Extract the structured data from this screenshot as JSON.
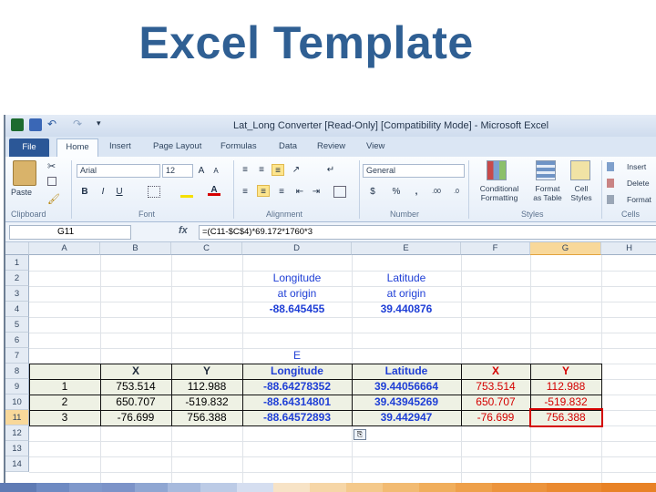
{
  "slide": {
    "title": "Excel Template"
  },
  "window": {
    "title": "Lat_Long Converter [Read-Only] [Compatibility Mode] - Microsoft Excel"
  },
  "tabs": [
    "File",
    "Home",
    "Insert",
    "Page Layout",
    "Formulas",
    "Data",
    "Review",
    "View"
  ],
  "ribbon": {
    "clipboard": {
      "paste": "Paste",
      "label": "Clipboard"
    },
    "font": {
      "name": "Arial",
      "size": "12",
      "label": "Font",
      "bold": "B",
      "italic": "I",
      "underline": "U"
    },
    "alignment": {
      "label": "Alignment"
    },
    "number": {
      "format": "General",
      "label": "Number",
      "currency": "$",
      "percent": "%",
      "comma": ","
    },
    "styles": {
      "conditional": "Conditional Formatting",
      "table": "Format as Table",
      "cell": "Cell Styles",
      "label": "Styles"
    },
    "cells": {
      "insert": "Insert",
      "delete": "Delete",
      "format": "Format",
      "label": "Cells"
    }
  },
  "formula_bar": {
    "name_box": "G11",
    "fx": "fx",
    "formula": "=(C11-$C$4)*69.172*1760*3"
  },
  "columns": [
    "A",
    "B",
    "C",
    "D",
    "E",
    "F",
    "G",
    "H"
  ],
  "rows": [
    "1",
    "2",
    "3",
    "4",
    "5",
    "6",
    "7",
    "8",
    "9",
    "10",
    "11",
    "12",
    "13",
    "14"
  ],
  "sheet": {
    "origin_long_label1": "Longitude",
    "origin_long_label2": "at origin",
    "origin_long_value": "-88.645455",
    "origin_lat_label1": "Latitude",
    "origin_lat_label2": "at origin",
    "origin_lat_value": "39.440876",
    "e_label": "E",
    "headers": [
      "X",
      "Y",
      "Longitude",
      "Latitude",
      "X",
      "Y"
    ],
    "data": [
      {
        "a": "1",
        "b": "753.514",
        "c": "112.988",
        "d": "-88.64278352",
        "e": "39.44056664",
        "f": "753.514",
        "g": "112.988"
      },
      {
        "a": "2",
        "b": "650.707",
        "c": "-519.832",
        "d": "-88.64314801",
        "e": "39.43945269",
        "f": "650.707",
        "g": "-519.832"
      },
      {
        "a": "3",
        "b": "-76.699",
        "c": "756.388",
        "d": "-88.64572893",
        "e": "39.442947",
        "f": "-76.699",
        "g": "756.388"
      }
    ]
  },
  "colors": {
    "title": "#2f5f93",
    "blue": "#1f3fd6",
    "red": "#d40000",
    "table_fill": "#eef1e4",
    "selection": "#d40000"
  }
}
